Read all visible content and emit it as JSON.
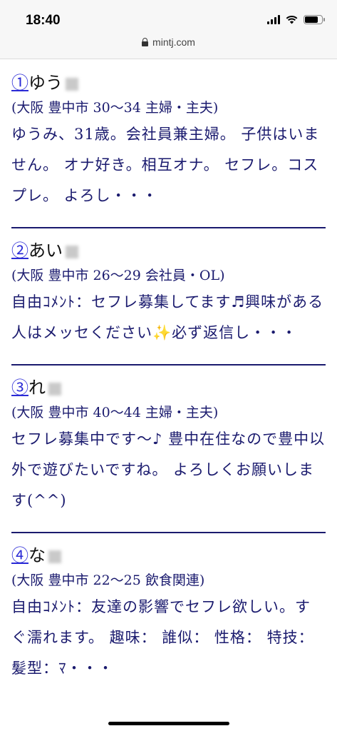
{
  "status": {
    "time": "18:40"
  },
  "browser": {
    "url": "mintj.com"
  },
  "entries": [
    {
      "num": "①",
      "name": "ゆう",
      "meta": "(大阪 豊中市 30〜34 主婦・主夫)",
      "desc": "ゆうみ、31歳。会社員兼主婦。 子供はいません。 オナ好き。相互オナ。 セフレ。コスプレ。 よろし・・・"
    },
    {
      "num": "②",
      "name": "あい",
      "meta": "(大阪 豊中市 26〜29 会社員・OL)",
      "desc": "自由ｺﾒﾝﾄ：セフレ募集してます♬興味がある人はメッセください✨必ず返信し・・・"
    },
    {
      "num": "③",
      "name": "れ",
      "meta": "(大阪 豊中市 40〜44 主婦・主夫)",
      "desc": "セフレ募集中です〜♪ 豊中在住なので豊中以外で遊びたいですね。 よろしくお願いします(^^)"
    },
    {
      "num": "④",
      "name": "な",
      "meta": "(大阪 豊中市 22〜25 飲食関連)",
      "desc": "自由ｺﾒﾝﾄ：友達の影響でセフレ欲しい。すぐ濡れます。 趣味： 誰似： 性格： 特技： 髪型：ﾏ・・・"
    }
  ]
}
